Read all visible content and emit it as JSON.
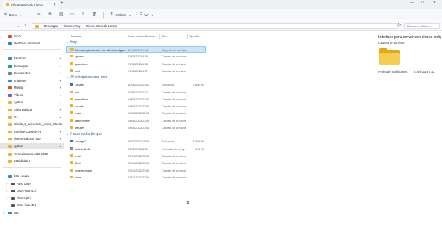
{
  "window": {
    "tab_title": "Cliente Interlude Limpio",
    "new_tab": "+",
    "controls": [
      "—",
      "☐",
      "✕"
    ]
  },
  "toolbar": {
    "new_label": "Nuevo",
    "sort_label": "Ordenar",
    "view_label": "Ver",
    "more_label": "···"
  },
  "address": {
    "crumbs": [
      "Descargas",
      "ClienteVirCry",
      "Cliente Interlude Limpio"
    ],
    "search_placeholder": "Buscar en Cliente..."
  },
  "sidebar": {
    "items": [
      {
        "label": "Inicio",
        "icon": "home-icon",
        "color": "#d14b3a"
      },
      {
        "label": "OneDrive - Personal",
        "icon": "cloud-icon",
        "color": "#2b78d6"
      },
      {
        "label": "Escritorio",
        "icon": "desktop-icon",
        "color": "#3a84c8"
      },
      {
        "label": "Descargas",
        "icon": "download-icon",
        "color": "#1f9f62"
      },
      {
        "label": "Documentos",
        "icon": "document-icon",
        "color": "#6f7d8c"
      },
      {
        "label": "Imágenes",
        "icon": "pictures-icon",
        "color": "#3a8fd8"
      },
      {
        "label": "Música",
        "icon": "music-icon",
        "color": "#d6522b"
      },
      {
        "label": "Vídeos",
        "icon": "video-icon",
        "color": "#8b4fc8"
      },
      {
        "label": "system",
        "icon": "folder-icon",
        "color": "#e8b52c"
      },
      {
        "label": "Silent DarkLite",
        "icon": "folder-icon",
        "color": "#e8b52c"
      },
      {
        "label": "G:\\",
        "icon": "folder-icon",
        "color": "#e8b52c"
      },
      {
        "label": "Gioulla_3_aniversario_nueva_interface",
        "icon": "folder-icon",
        "color": "#e8b52c"
      },
      {
        "label": "Interface CuervoKTR",
        "icon": "folder-icon",
        "color": "#e8b52c"
      },
      {
        "label": "sistemmode sin noto",
        "icon": "folder-icon",
        "color": "#e8b52c"
      },
      {
        "label": "system",
        "icon": "folder-icon",
        "color": "#e8b52c"
      },
      {
        "label": "Termodinamica AÑO 2023",
        "icon": "folder-icon",
        "color": "#e8b52c"
      },
      {
        "label": "Estabilidad II",
        "icon": "folder-icon",
        "color": "#e8b52c"
      },
      {
        "label": "Este equipo",
        "icon": "computer-icon",
        "color": "#3a84c8"
      },
      {
        "label": "A380 Drive",
        "icon": "drive-icon",
        "color": "#555555"
      },
      {
        "label": "Disco local (C:)",
        "icon": "drive-icon",
        "color": "#555555"
      },
      {
        "label": "Flamia (D:)",
        "icon": "drive-icon",
        "color": "#555555"
      },
      {
        "label": "Disco local (E:)",
        "icon": "drive-icon",
        "color": "#555555"
      },
      {
        "label": "Red",
        "icon": "network-icon",
        "color": "#3a84c8"
      }
    ]
  },
  "columns": [
    "Nombre",
    "Fecha de modificación",
    "Tipo",
    "Tamaño"
  ],
  "groups": [
    {
      "label": "Hoy",
      "rows": [
        {
          "name": "Interface para server con cliente antiguo...",
          "date": "21/08/2023 8:32",
          "type": "Carpeta de archivos",
          "size": "",
          "kind": "folder"
        },
        {
          "name": "system",
          "date": "21/08/2023 4:38",
          "type": "Carpeta de archivos",
          "size": "",
          "kind": "folder"
        },
        {
          "name": "systextures",
          "date": "21/08/2023 4:38",
          "type": "Carpeta de archivos",
          "size": "",
          "kind": "folder"
        },
        {
          "name": "cred",
          "date": "21/08/2023 4:37",
          "type": "Carpeta de archivos",
          "size": "",
          "kind": "folder"
        }
      ]
    },
    {
      "label": "Al principio de este mes",
      "rows": [
        {
          "name": "Updater",
          "date": "10/08/2023 20:51",
          "type": "Aplicación",
          "size": "7.898 KB",
          "kind": "app"
        },
        {
          "name": "lock",
          "date": "10/08/2023 1:32",
          "type": "Carpeta de archivos",
          "size": "",
          "kind": "folder"
        },
        {
          "name": "animations",
          "date": "04/08/2023 20:07",
          "type": "Carpeta de archivos",
          "size": "",
          "kind": "folder"
        },
        {
          "name": "sounds",
          "date": "04/08/2023 20:04",
          "type": "Carpeta de archivos",
          "size": "",
          "kind": "folder"
        },
        {
          "name": "maps",
          "date": "04/08/2023 20:04",
          "type": "Carpeta de archivos",
          "size": "",
          "kind": "folder"
        },
        {
          "name": "staticmeshes",
          "date": "04/08/2023 20:04",
          "type": "Carpeta de archivos",
          "size": "",
          "kind": "folder"
        },
        {
          "name": "textures",
          "date": "04/08/2023 20:04",
          "type": "Carpeta de archivos",
          "size": "",
          "kind": "folder"
        }
      ]
    },
    {
      "label": "Hace mucho tiempo",
      "rows": [
        {
          "name": "Lineage2",
          "date": "20/02/2007 13:00",
          "type": "Aplicación",
          "size": "1.508 KB",
          "kind": "app"
        },
        {
          "name": "patchw32.dll",
          "date": "06/02/2006 8:51",
          "type": "Extensión de la ap...",
          "size": "192 KB",
          "kind": "dll"
        },
        {
          "name": "music",
          "date": "22/04/2022 20:05",
          "type": "Carpeta de archivos",
          "size": "",
          "kind": "folder"
        },
        {
          "name": "l2text",
          "date": "22/04/2022 20:05",
          "type": "Carpeta de archivos",
          "size": "",
          "kind": "folder"
        },
        {
          "name": "forcefeedback",
          "date": "22/04/2022 20:05",
          "type": "Carpeta de archivos",
          "size": "",
          "kind": "folder"
        },
        {
          "name": "voice",
          "date": "22/04/2022 20:05",
          "type": "Carpeta de archivos",
          "size": "",
          "kind": "folder"
        }
      ]
    }
  ],
  "details": {
    "title": "Interface para server con cliente antiguo",
    "subtitle": "Carpeta de archivos",
    "modified_label": "Fecha de modificación:",
    "modified_value": "21/08/2023 8:32"
  }
}
